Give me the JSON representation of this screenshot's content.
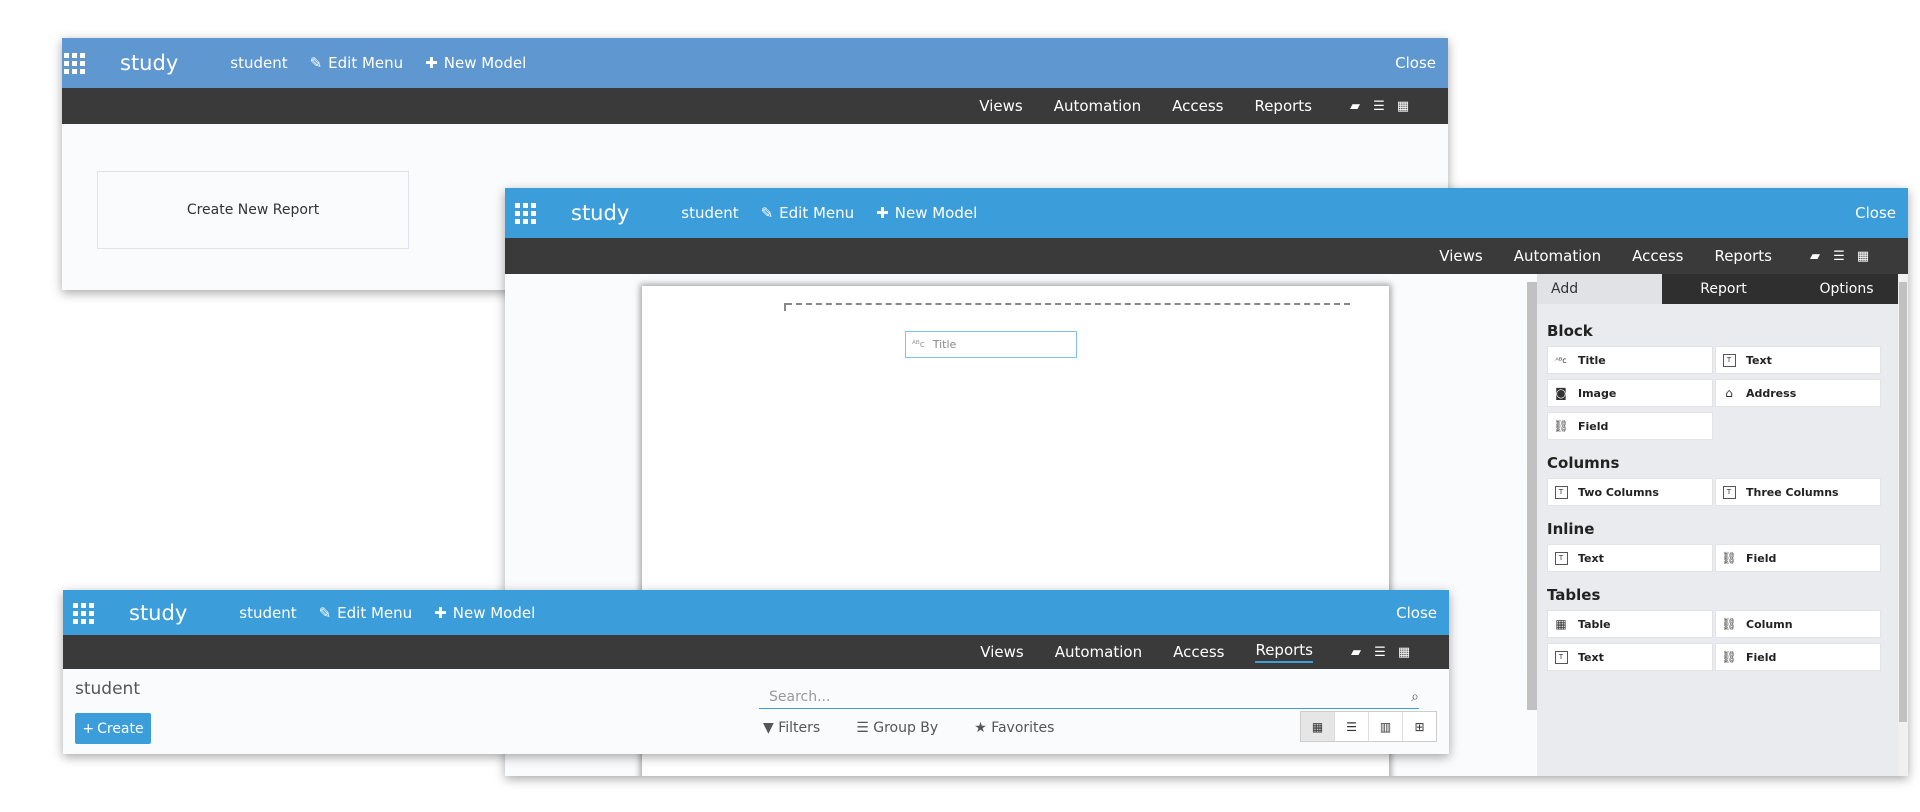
{
  "apps_icon": "apps-grid-icon",
  "w1": {
    "brand": "study",
    "nav": [
      "student",
      "Edit Menu",
      "New Model"
    ],
    "close": "Close",
    "tabs": [
      "Views",
      "Automation",
      "Access",
      "Reports"
    ],
    "create_report": "Create New Report"
  },
  "w2": {
    "brand": "study",
    "nav": [
      "student",
      "Edit Menu",
      "New Model"
    ],
    "close": "Close",
    "tabs": [
      "Views",
      "Automation",
      "Access",
      "Reports"
    ],
    "canvas_title": "Title",
    "sidebar_tabs": [
      "Add",
      "Report",
      "Options"
    ],
    "sections": {
      "block": {
        "heading": "Block",
        "items": [
          "Title",
          "Text",
          "Image",
          "Address",
          "Field"
        ]
      },
      "columns": {
        "heading": "Columns",
        "items": [
          "Two Columns",
          "Three Columns"
        ]
      },
      "inline": {
        "heading": "Inline",
        "items": [
          "Text",
          "Field"
        ]
      },
      "tables": {
        "heading": "Tables",
        "items": [
          "Table",
          "Column",
          "Text",
          "Field"
        ]
      }
    }
  },
  "w3": {
    "brand": "study",
    "nav": [
      "student",
      "Edit Menu",
      "New Model"
    ],
    "close": "Close",
    "tabs": [
      "Views",
      "Automation",
      "Access",
      "Reports"
    ],
    "list_title": "student",
    "create_label": "Create",
    "search_placeholder": "Search...",
    "filters": [
      "Filters",
      "Group By",
      "Favorites"
    ]
  },
  "colors": {
    "topbar_light": "#5f97d0",
    "topbar": "#3c9ddb",
    "subbar": "#3a3a3a"
  }
}
